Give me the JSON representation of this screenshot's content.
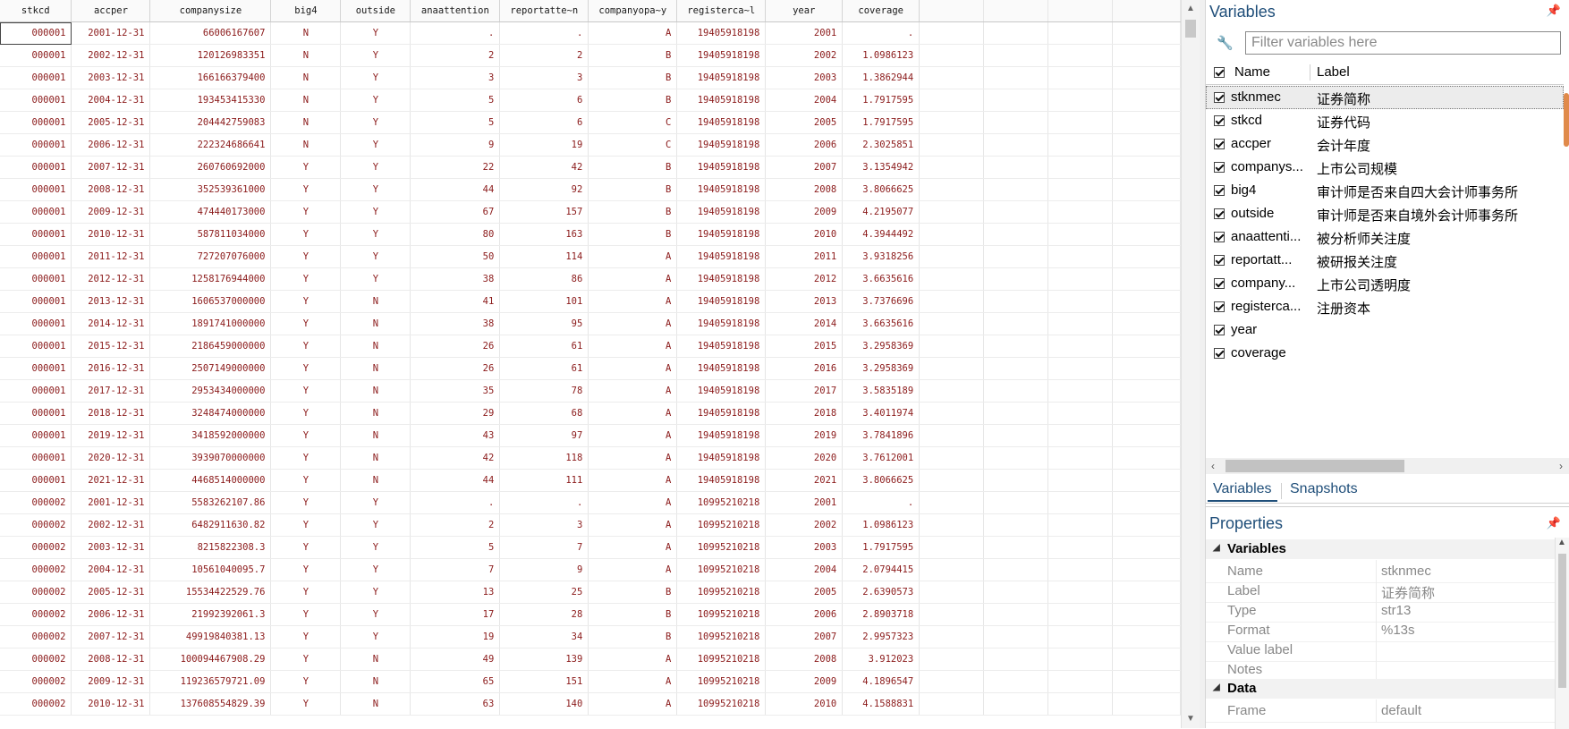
{
  "grid": {
    "columns": [
      "stkcd",
      "accper",
      "companysize",
      "big4",
      "outside",
      "anaattention",
      "reportatte~n",
      "companyopa~y",
      "registerca~l",
      "year",
      "coverage"
    ],
    "rows": [
      [
        "000001",
        "2001-12-31",
        "66006167607",
        "N",
        "Y",
        ".",
        ".",
        "A",
        "19405918198",
        "2001",
        "."
      ],
      [
        "000001",
        "2002-12-31",
        "120126983351",
        "N",
        "Y",
        "2",
        "2",
        "B",
        "19405918198",
        "2002",
        "1.0986123"
      ],
      [
        "000001",
        "2003-12-31",
        "166166379400",
        "N",
        "Y",
        "3",
        "3",
        "B",
        "19405918198",
        "2003",
        "1.3862944"
      ],
      [
        "000001",
        "2004-12-31",
        "193453415330",
        "N",
        "Y",
        "5",
        "6",
        "B",
        "19405918198",
        "2004",
        "1.7917595"
      ],
      [
        "000001",
        "2005-12-31",
        "204442759083",
        "N",
        "Y",
        "5",
        "6",
        "C",
        "19405918198",
        "2005",
        "1.7917595"
      ],
      [
        "000001",
        "2006-12-31",
        "222324686641",
        "N",
        "Y",
        "9",
        "19",
        "C",
        "19405918198",
        "2006",
        "2.3025851"
      ],
      [
        "000001",
        "2007-12-31",
        "260760692000",
        "Y",
        "Y",
        "22",
        "42",
        "B",
        "19405918198",
        "2007",
        "3.1354942"
      ],
      [
        "000001",
        "2008-12-31",
        "352539361000",
        "Y",
        "Y",
        "44",
        "92",
        "B",
        "19405918198",
        "2008",
        "3.8066625"
      ],
      [
        "000001",
        "2009-12-31",
        "474440173000",
        "Y",
        "Y",
        "67",
        "157",
        "B",
        "19405918198",
        "2009",
        "4.2195077"
      ],
      [
        "000001",
        "2010-12-31",
        "587811034000",
        "Y",
        "Y",
        "80",
        "163",
        "B",
        "19405918198",
        "2010",
        "4.3944492"
      ],
      [
        "000001",
        "2011-12-31",
        "727207076000",
        "Y",
        "Y",
        "50",
        "114",
        "A",
        "19405918198",
        "2011",
        "3.9318256"
      ],
      [
        "000001",
        "2012-12-31",
        "1258176944000",
        "Y",
        "Y",
        "38",
        "86",
        "A",
        "19405918198",
        "2012",
        "3.6635616"
      ],
      [
        "000001",
        "2013-12-31",
        "1606537000000",
        "Y",
        "N",
        "41",
        "101",
        "A",
        "19405918198",
        "2013",
        "3.7376696"
      ],
      [
        "000001",
        "2014-12-31",
        "1891741000000",
        "Y",
        "N",
        "38",
        "95",
        "A",
        "19405918198",
        "2014",
        "3.6635616"
      ],
      [
        "000001",
        "2015-12-31",
        "2186459000000",
        "Y",
        "N",
        "26",
        "61",
        "A",
        "19405918198",
        "2015",
        "3.2958369"
      ],
      [
        "000001",
        "2016-12-31",
        "2507149000000",
        "Y",
        "N",
        "26",
        "61",
        "A",
        "19405918198",
        "2016",
        "3.2958369"
      ],
      [
        "000001",
        "2017-12-31",
        "2953434000000",
        "Y",
        "N",
        "35",
        "78",
        "A",
        "19405918198",
        "2017",
        "3.5835189"
      ],
      [
        "000001",
        "2018-12-31",
        "3248474000000",
        "Y",
        "N",
        "29",
        "68",
        "A",
        "19405918198",
        "2018",
        "3.4011974"
      ],
      [
        "000001",
        "2019-12-31",
        "3418592000000",
        "Y",
        "N",
        "43",
        "97",
        "A",
        "19405918198",
        "2019",
        "3.7841896"
      ],
      [
        "000001",
        "2020-12-31",
        "3939070000000",
        "Y",
        "N",
        "42",
        "118",
        "A",
        "19405918198",
        "2020",
        "3.7612001"
      ],
      [
        "000001",
        "2021-12-31",
        "4468514000000",
        "Y",
        "N",
        "44",
        "111",
        "A",
        "19405918198",
        "2021",
        "3.8066625"
      ],
      [
        "000002",
        "2001-12-31",
        "5583262107.86",
        "Y",
        "Y",
        ".",
        ".",
        "A",
        "10995210218",
        "2001",
        "."
      ],
      [
        "000002",
        "2002-12-31",
        "6482911630.82",
        "Y",
        "Y",
        "2",
        "3",
        "A",
        "10995210218",
        "2002",
        "1.0986123"
      ],
      [
        "000002",
        "2003-12-31",
        "8215822308.3",
        "Y",
        "Y",
        "5",
        "7",
        "A",
        "10995210218",
        "2003",
        "1.7917595"
      ],
      [
        "000002",
        "2004-12-31",
        "10561040095.7",
        "Y",
        "Y",
        "7",
        "9",
        "A",
        "10995210218",
        "2004",
        "2.0794415"
      ],
      [
        "000002",
        "2005-12-31",
        "15534422529.76",
        "Y",
        "Y",
        "13",
        "25",
        "B",
        "10995210218",
        "2005",
        "2.6390573"
      ],
      [
        "000002",
        "2006-12-31",
        "21992392061.3",
        "Y",
        "Y",
        "17",
        "28",
        "B",
        "10995210218",
        "2006",
        "2.8903718"
      ],
      [
        "000002",
        "2007-12-31",
        "49919840381.13",
        "Y",
        "Y",
        "19",
        "34",
        "B",
        "10995210218",
        "2007",
        "2.9957323"
      ],
      [
        "000002",
        "2008-12-31",
        "100094467908.29",
        "Y",
        "N",
        "49",
        "139",
        "A",
        "10995210218",
        "2008",
        "3.912023"
      ],
      [
        "000002",
        "2009-12-31",
        "119236579721.09",
        "Y",
        "N",
        "65",
        "151",
        "A",
        "10995210218",
        "2009",
        "4.1896547"
      ],
      [
        "000002",
        "2010-12-31",
        "137608554829.39",
        "Y",
        "N",
        "63",
        "140",
        "A",
        "10995210218",
        "2010",
        "4.1588831"
      ]
    ]
  },
  "variables": {
    "title": "Variables",
    "filter_placeholder": "Filter variables here",
    "col_name": "Name",
    "col_label": "Label",
    "items": [
      {
        "name": "stknmec",
        "label": "证券简称"
      },
      {
        "name": "stkcd",
        "label": "证券代码"
      },
      {
        "name": "accper",
        "label": "会计年度"
      },
      {
        "name": "companys...",
        "label": "上市公司规模"
      },
      {
        "name": "big4",
        "label": "审计师是否来自四大会计师事务所"
      },
      {
        "name": "outside",
        "label": "审计师是否来自境外会计师事务所"
      },
      {
        "name": "anaattenti...",
        "label": "被分析师关注度"
      },
      {
        "name": "reportatt...",
        "label": "被研报关注度"
      },
      {
        "name": "company...",
        "label": "上市公司透明度"
      },
      {
        "name": "registerca...",
        "label": "注册资本"
      },
      {
        "name": "year",
        "label": ""
      },
      {
        "name": "coverage",
        "label": ""
      }
    ]
  },
  "tabs": {
    "variables": "Variables",
    "snapshots": "Snapshots"
  },
  "properties": {
    "title": "Properties",
    "section_variables": "Variables",
    "name_key": "Name",
    "name_val": "stknmec",
    "label_key": "Label",
    "label_val": "证券简称",
    "type_key": "Type",
    "type_val": "str13",
    "format_key": "Format",
    "format_val": "%13s",
    "vlabel_key": "Value label",
    "vlabel_val": "",
    "notes_key": "Notes",
    "notes_val": "",
    "section_data": "Data",
    "frame_key": "Frame",
    "frame_val": "default"
  }
}
